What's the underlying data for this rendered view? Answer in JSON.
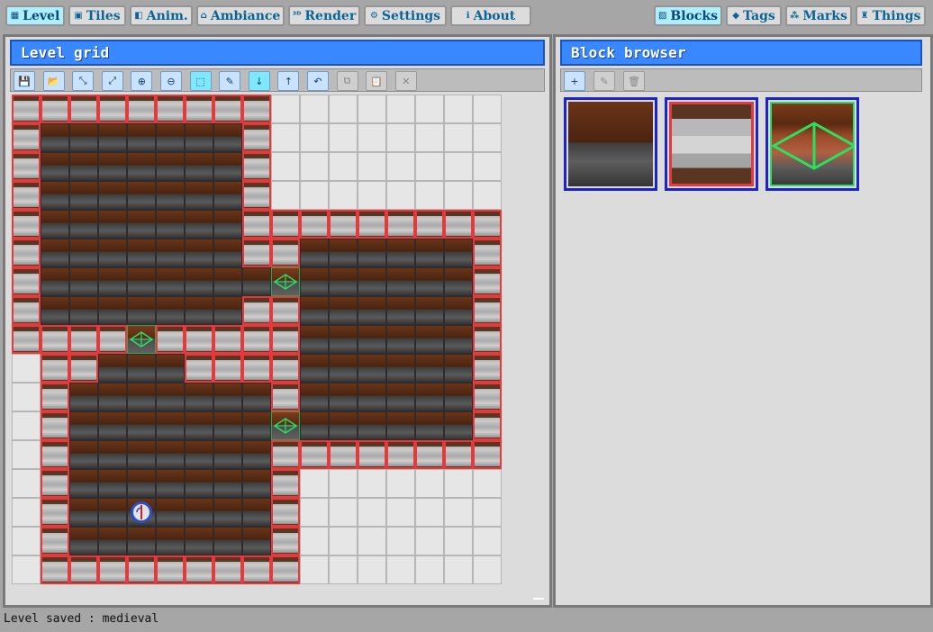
{
  "menu_left": [
    {
      "label": "Level",
      "icon": "grid-icon",
      "glyph": "▦",
      "active": true
    },
    {
      "label": "Tiles",
      "icon": "images-icon",
      "glyph": "▣",
      "active": false
    },
    {
      "label": "Anim.",
      "icon": "film-icon",
      "glyph": "◧",
      "active": false
    },
    {
      "label": "Ambiance",
      "icon": "home-icon",
      "glyph": "⌂",
      "active": false
    },
    {
      "label": "Render",
      "icon": "3d-icon",
      "glyph": "³ᴰ",
      "active": false
    },
    {
      "label": "Settings",
      "icon": "gear-icon",
      "glyph": "⚙",
      "active": false
    },
    {
      "label": "About",
      "icon": "info-icon",
      "glyph": "ℹ",
      "active": false
    }
  ],
  "menu_right": [
    {
      "label": "Blocks",
      "icon": "hatch-icon",
      "glyph": "▨",
      "active": true
    },
    {
      "label": "Tags",
      "icon": "tag-icon",
      "glyph": "◆",
      "active": false
    },
    {
      "label": "Marks",
      "icon": "marks-icon",
      "glyph": "⁂",
      "active": false
    },
    {
      "label": "Things",
      "icon": "rook-icon",
      "glyph": "♜",
      "active": false
    }
  ],
  "level_panel": {
    "title": "Level grid",
    "tools": [
      {
        "name": "save-icon",
        "glyph": "💾",
        "state": "normal"
      },
      {
        "name": "open-folder-icon",
        "glyph": "📂",
        "state": "normal"
      },
      {
        "name": "shrink-icon",
        "glyph": "⤡",
        "state": "normal"
      },
      {
        "name": "expand-icon",
        "glyph": "⤢",
        "state": "normal"
      },
      {
        "name": "zoom-in-icon",
        "glyph": "⊕",
        "state": "normal"
      },
      {
        "name": "zoom-out-icon",
        "glyph": "⊖",
        "state": "normal"
      },
      {
        "name": "select-icon",
        "glyph": "⬚",
        "state": "highlight"
      },
      {
        "name": "pencil-icon",
        "glyph": "✎",
        "state": "normal"
      },
      {
        "name": "arrow-down-icon",
        "glyph": "↓",
        "state": "highlight"
      },
      {
        "name": "arrow-up-icon",
        "glyph": "↑",
        "state": "normal"
      },
      {
        "name": "undo-icon",
        "glyph": "↶",
        "state": "normal"
      },
      {
        "name": "copy-icon",
        "glyph": "⧉",
        "state": "disabled"
      },
      {
        "name": "paste-icon",
        "glyph": "📋",
        "state": "disabled"
      },
      {
        "name": "close-icon",
        "glyph": "✕",
        "state": "disabled"
      }
    ],
    "grid_rows": [
      "WWWWWWWWW........",
      "WFFFFFFFW........",
      "WFFFFFFFW........",
      "WFFFFFFFW........",
      "WFFFFFFFWWWWWWWWW",
      "WFFFFFFFWWFFFFFFW",
      "WFFFFFFFFTFFFFFFW",
      "WFFFFFFFWWFFFFFFW",
      "WWWWTWWWWWFFFFFFW",
      ".WWFFFWWWWFFFFFFW",
      ".WFFFFFFFWFFFFFFW",
      ".WFFFFFFFTFFFFFFW",
      ".WFFFFFFFWWWWWWWW",
      ".WFFFFFFFW.......",
      ".WFFFFFFFW.......",
      ".WFFFFFFFW.......",
      ".WWWWWWWWW......."
    ],
    "player": {
      "row": 14,
      "col": 4
    }
  },
  "block_panel": {
    "title": "Block browser",
    "tools": [
      {
        "name": "add-icon",
        "glyph": "+",
        "state": "normal"
      },
      {
        "name": "edit-icon",
        "glyph": "✎",
        "state": "disabled"
      },
      {
        "name": "trash-icon",
        "glyph": "🗑",
        "state": "disabled"
      }
    ],
    "blocks": [
      {
        "name": "block-floor"
      },
      {
        "name": "block-wall"
      },
      {
        "name": "block-trigger"
      }
    ]
  },
  "status": "Level saved : medieval",
  "colors": {
    "accent": "#3a88ff",
    "wall_border": "#e8383c",
    "trigger": "#2be060",
    "block_frame": "#1c24c8"
  }
}
